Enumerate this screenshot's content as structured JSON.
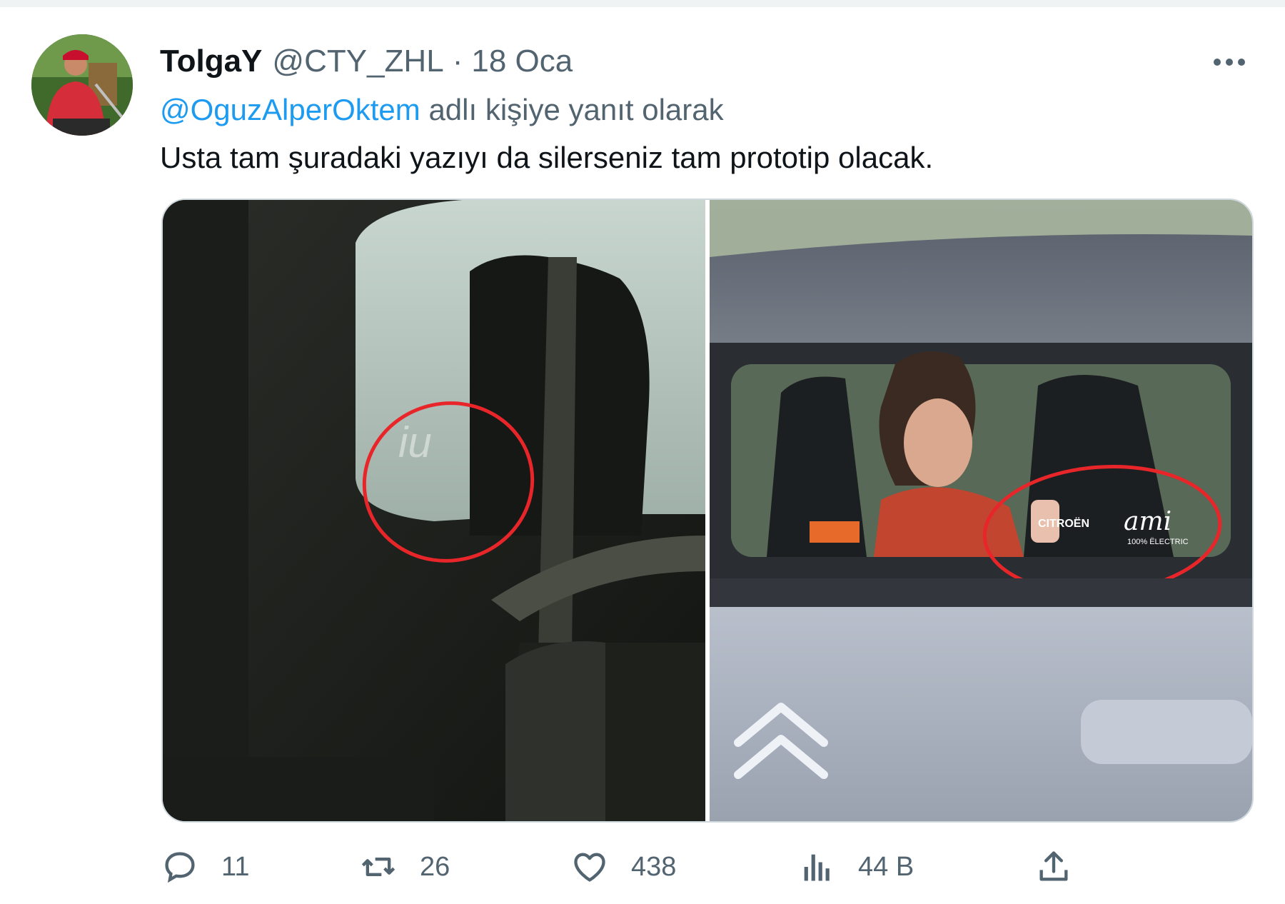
{
  "tweet": {
    "display_name": "TolgaY",
    "handle": "@CTY_ZHL",
    "separator": "·",
    "date": "18 Oca",
    "reply_to_mention": "@OguzAlperOktem",
    "reply_suffix": "adlı kişiye yanıt olarak",
    "text": "Usta tam şuradaki yazıyı da silerseniz tam prototip olacak."
  },
  "media": {
    "right_badge_brand": "CITROËN",
    "right_badge_model": "ami",
    "right_badge_sub": "100% ËLECTRIC",
    "annotation_color": "#e8262a"
  },
  "actions": {
    "reply_count": "11",
    "retweet_count": "26",
    "like_count": "438",
    "views_count": "44 B"
  },
  "icons": {
    "more": "more-icon",
    "reply": "reply-icon",
    "retweet": "retweet-icon",
    "like": "heart-icon",
    "views": "views-icon",
    "share": "share-icon"
  },
  "colors": {
    "text": "#0f1419",
    "secondary": "#536471",
    "link": "#1d9bf0"
  }
}
